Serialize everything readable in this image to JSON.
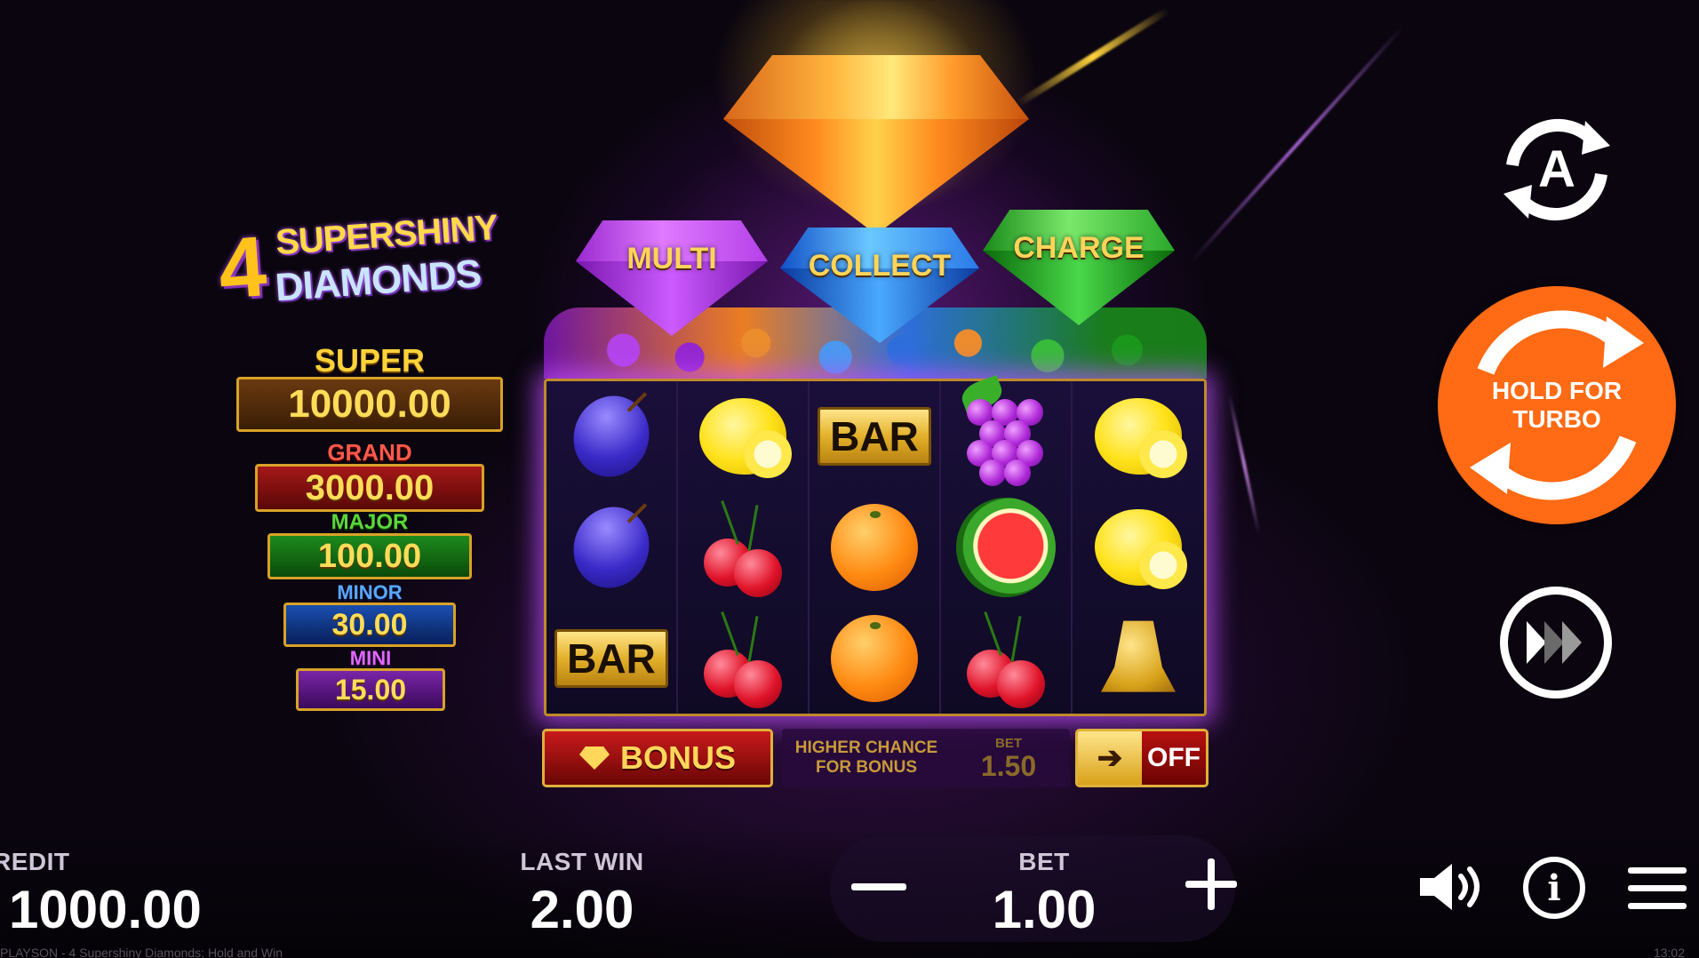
{
  "game": {
    "logo_number": "4",
    "logo_line1": "SUPERSHINY",
    "logo_line2": "DIAMONDS"
  },
  "jackpots": [
    {
      "label": "SUPER",
      "value": "10000.00",
      "color": "#ffd23a"
    },
    {
      "label": "GRAND",
      "value": "3000.00",
      "color": "#ff5a4a"
    },
    {
      "label": "MAJOR",
      "value": "100.00",
      "color": "#5bd63a"
    },
    {
      "label": "MINOR",
      "value": "30.00",
      "color": "#5aa8ff"
    },
    {
      "label": "MINI",
      "value": "15.00",
      "color": "#e068ff"
    }
  ],
  "diamonds": {
    "multi": "MULTI",
    "collect": "COLLECT",
    "charge": "CHARGE"
  },
  "reels": [
    [
      "plum",
      "lemon",
      "bar",
      "grapes",
      "lemon"
    ],
    [
      "plum",
      "cherries",
      "orange",
      "watermelon",
      "lemon"
    ],
    [
      "bar",
      "cherries",
      "orange",
      "cherries",
      "bell"
    ]
  ],
  "symbol_text": {
    "bar": "BAR"
  },
  "bonus": {
    "button_label": "BONUS",
    "chance_text_line1": "HIGHER CHANCE",
    "chance_text_line2": "FOR BONUS",
    "bet_label": "BET",
    "bet_value": "1.50",
    "toggle_state": "OFF"
  },
  "controls": {
    "autoplay_letter": "A",
    "spin_line1": "HOLD FOR",
    "spin_line2": "TURBO",
    "spin_color": "#ff6a14"
  },
  "stats": {
    "credit_label": "REDIT",
    "credit_value": "1000.00",
    "last_win_label": "LAST WIN",
    "last_win_value": "2.00",
    "bet_label": "BET",
    "bet_value": "1.00"
  },
  "icons": {
    "sound": "speaker-icon",
    "info": "info-icon",
    "menu": "hamburger-icon",
    "info_glyph": "i"
  },
  "footer": {
    "left": "PLAYSON - 4 Supershiny Diamonds: Hold and Win",
    "right": "13:02"
  }
}
